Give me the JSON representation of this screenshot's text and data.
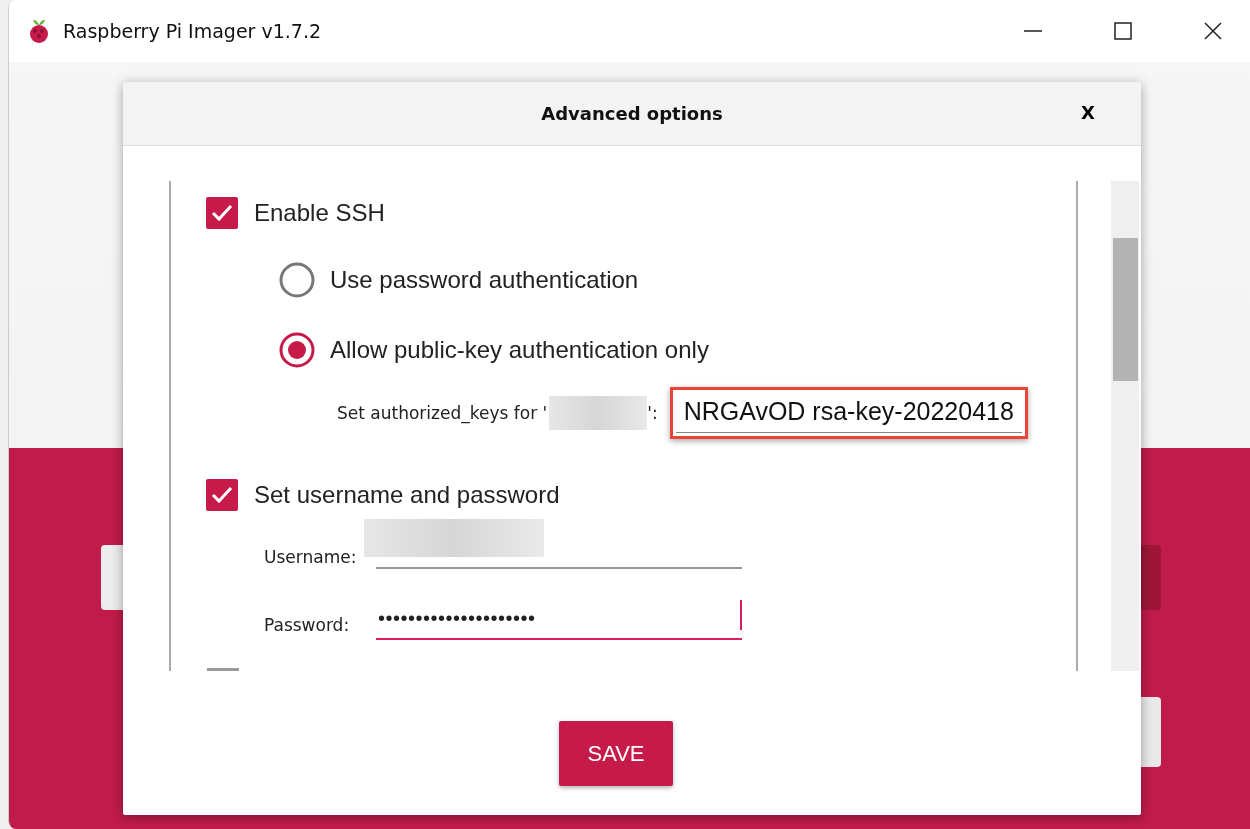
{
  "window": {
    "title": "Raspberry Pi Imager v1.7.2"
  },
  "dialog": {
    "title": "Advanced options",
    "close": "X",
    "options": [
      {
        "kind": "checkbox",
        "label": "Enable SSH",
        "checked": true,
        "children": [
          {
            "kind": "radio",
            "label": "Use password authentication",
            "selected": false
          },
          {
            "kind": "radio",
            "label": "Allow public-key authentication only",
            "selected": true
          },
          {
            "kind": "keyfield",
            "label": "Set authorized_keys for '",
            "label_end": "':",
            "value": "NRGAvOD rsa-key-20220418",
            "highlighted": true
          }
        ]
      },
      {
        "kind": "checkbox",
        "label": "Set username and password",
        "checked": true,
        "children": [
          {
            "kind": "field",
            "label": "Username:",
            "redacted": true,
            "focused": false
          },
          {
            "kind": "field",
            "label": "Password:",
            "value": "•••••••••••••••••••••",
            "focused": true
          }
        ]
      }
    ],
    "save_button": "SAVE"
  }
}
